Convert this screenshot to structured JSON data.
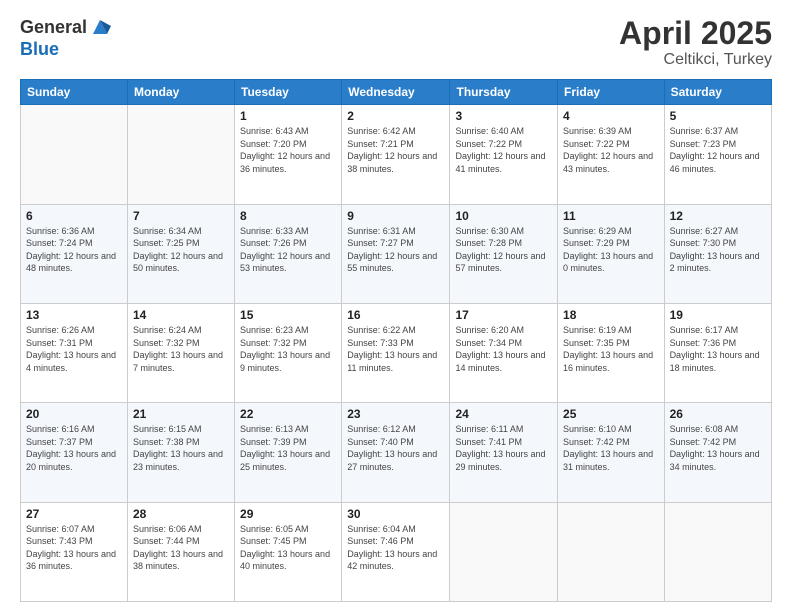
{
  "header": {
    "logo_general": "General",
    "logo_blue": "Blue",
    "title": "April 2025",
    "subtitle": "Celtikci, Turkey"
  },
  "weekdays": [
    "Sunday",
    "Monday",
    "Tuesday",
    "Wednesday",
    "Thursday",
    "Friday",
    "Saturday"
  ],
  "weeks": [
    [
      {
        "day": "",
        "sunrise": "",
        "sunset": "",
        "daylight": ""
      },
      {
        "day": "",
        "sunrise": "",
        "sunset": "",
        "daylight": ""
      },
      {
        "day": "1",
        "sunrise": "Sunrise: 6:43 AM",
        "sunset": "Sunset: 7:20 PM",
        "daylight": "Daylight: 12 hours and 36 minutes."
      },
      {
        "day": "2",
        "sunrise": "Sunrise: 6:42 AM",
        "sunset": "Sunset: 7:21 PM",
        "daylight": "Daylight: 12 hours and 38 minutes."
      },
      {
        "day": "3",
        "sunrise": "Sunrise: 6:40 AM",
        "sunset": "Sunset: 7:22 PM",
        "daylight": "Daylight: 12 hours and 41 minutes."
      },
      {
        "day": "4",
        "sunrise": "Sunrise: 6:39 AM",
        "sunset": "Sunset: 7:22 PM",
        "daylight": "Daylight: 12 hours and 43 minutes."
      },
      {
        "day": "5",
        "sunrise": "Sunrise: 6:37 AM",
        "sunset": "Sunset: 7:23 PM",
        "daylight": "Daylight: 12 hours and 46 minutes."
      }
    ],
    [
      {
        "day": "6",
        "sunrise": "Sunrise: 6:36 AM",
        "sunset": "Sunset: 7:24 PM",
        "daylight": "Daylight: 12 hours and 48 minutes."
      },
      {
        "day": "7",
        "sunrise": "Sunrise: 6:34 AM",
        "sunset": "Sunset: 7:25 PM",
        "daylight": "Daylight: 12 hours and 50 minutes."
      },
      {
        "day": "8",
        "sunrise": "Sunrise: 6:33 AM",
        "sunset": "Sunset: 7:26 PM",
        "daylight": "Daylight: 12 hours and 53 minutes."
      },
      {
        "day": "9",
        "sunrise": "Sunrise: 6:31 AM",
        "sunset": "Sunset: 7:27 PM",
        "daylight": "Daylight: 12 hours and 55 minutes."
      },
      {
        "day": "10",
        "sunrise": "Sunrise: 6:30 AM",
        "sunset": "Sunset: 7:28 PM",
        "daylight": "Daylight: 12 hours and 57 minutes."
      },
      {
        "day": "11",
        "sunrise": "Sunrise: 6:29 AM",
        "sunset": "Sunset: 7:29 PM",
        "daylight": "Daylight: 13 hours and 0 minutes."
      },
      {
        "day": "12",
        "sunrise": "Sunrise: 6:27 AM",
        "sunset": "Sunset: 7:30 PM",
        "daylight": "Daylight: 13 hours and 2 minutes."
      }
    ],
    [
      {
        "day": "13",
        "sunrise": "Sunrise: 6:26 AM",
        "sunset": "Sunset: 7:31 PM",
        "daylight": "Daylight: 13 hours and 4 minutes."
      },
      {
        "day": "14",
        "sunrise": "Sunrise: 6:24 AM",
        "sunset": "Sunset: 7:32 PM",
        "daylight": "Daylight: 13 hours and 7 minutes."
      },
      {
        "day": "15",
        "sunrise": "Sunrise: 6:23 AM",
        "sunset": "Sunset: 7:32 PM",
        "daylight": "Daylight: 13 hours and 9 minutes."
      },
      {
        "day": "16",
        "sunrise": "Sunrise: 6:22 AM",
        "sunset": "Sunset: 7:33 PM",
        "daylight": "Daylight: 13 hours and 11 minutes."
      },
      {
        "day": "17",
        "sunrise": "Sunrise: 6:20 AM",
        "sunset": "Sunset: 7:34 PM",
        "daylight": "Daylight: 13 hours and 14 minutes."
      },
      {
        "day": "18",
        "sunrise": "Sunrise: 6:19 AM",
        "sunset": "Sunset: 7:35 PM",
        "daylight": "Daylight: 13 hours and 16 minutes."
      },
      {
        "day": "19",
        "sunrise": "Sunrise: 6:17 AM",
        "sunset": "Sunset: 7:36 PM",
        "daylight": "Daylight: 13 hours and 18 minutes."
      }
    ],
    [
      {
        "day": "20",
        "sunrise": "Sunrise: 6:16 AM",
        "sunset": "Sunset: 7:37 PM",
        "daylight": "Daylight: 13 hours and 20 minutes."
      },
      {
        "day": "21",
        "sunrise": "Sunrise: 6:15 AM",
        "sunset": "Sunset: 7:38 PM",
        "daylight": "Daylight: 13 hours and 23 minutes."
      },
      {
        "day": "22",
        "sunrise": "Sunrise: 6:13 AM",
        "sunset": "Sunset: 7:39 PM",
        "daylight": "Daylight: 13 hours and 25 minutes."
      },
      {
        "day": "23",
        "sunrise": "Sunrise: 6:12 AM",
        "sunset": "Sunset: 7:40 PM",
        "daylight": "Daylight: 13 hours and 27 minutes."
      },
      {
        "day": "24",
        "sunrise": "Sunrise: 6:11 AM",
        "sunset": "Sunset: 7:41 PM",
        "daylight": "Daylight: 13 hours and 29 minutes."
      },
      {
        "day": "25",
        "sunrise": "Sunrise: 6:10 AM",
        "sunset": "Sunset: 7:42 PM",
        "daylight": "Daylight: 13 hours and 31 minutes."
      },
      {
        "day": "26",
        "sunrise": "Sunrise: 6:08 AM",
        "sunset": "Sunset: 7:42 PM",
        "daylight": "Daylight: 13 hours and 34 minutes."
      }
    ],
    [
      {
        "day": "27",
        "sunrise": "Sunrise: 6:07 AM",
        "sunset": "Sunset: 7:43 PM",
        "daylight": "Daylight: 13 hours and 36 minutes."
      },
      {
        "day": "28",
        "sunrise": "Sunrise: 6:06 AM",
        "sunset": "Sunset: 7:44 PM",
        "daylight": "Daylight: 13 hours and 38 minutes."
      },
      {
        "day": "29",
        "sunrise": "Sunrise: 6:05 AM",
        "sunset": "Sunset: 7:45 PM",
        "daylight": "Daylight: 13 hours and 40 minutes."
      },
      {
        "day": "30",
        "sunrise": "Sunrise: 6:04 AM",
        "sunset": "Sunset: 7:46 PM",
        "daylight": "Daylight: 13 hours and 42 minutes."
      },
      {
        "day": "",
        "sunrise": "",
        "sunset": "",
        "daylight": ""
      },
      {
        "day": "",
        "sunrise": "",
        "sunset": "",
        "daylight": ""
      },
      {
        "day": "",
        "sunrise": "",
        "sunset": "",
        "daylight": ""
      }
    ]
  ]
}
